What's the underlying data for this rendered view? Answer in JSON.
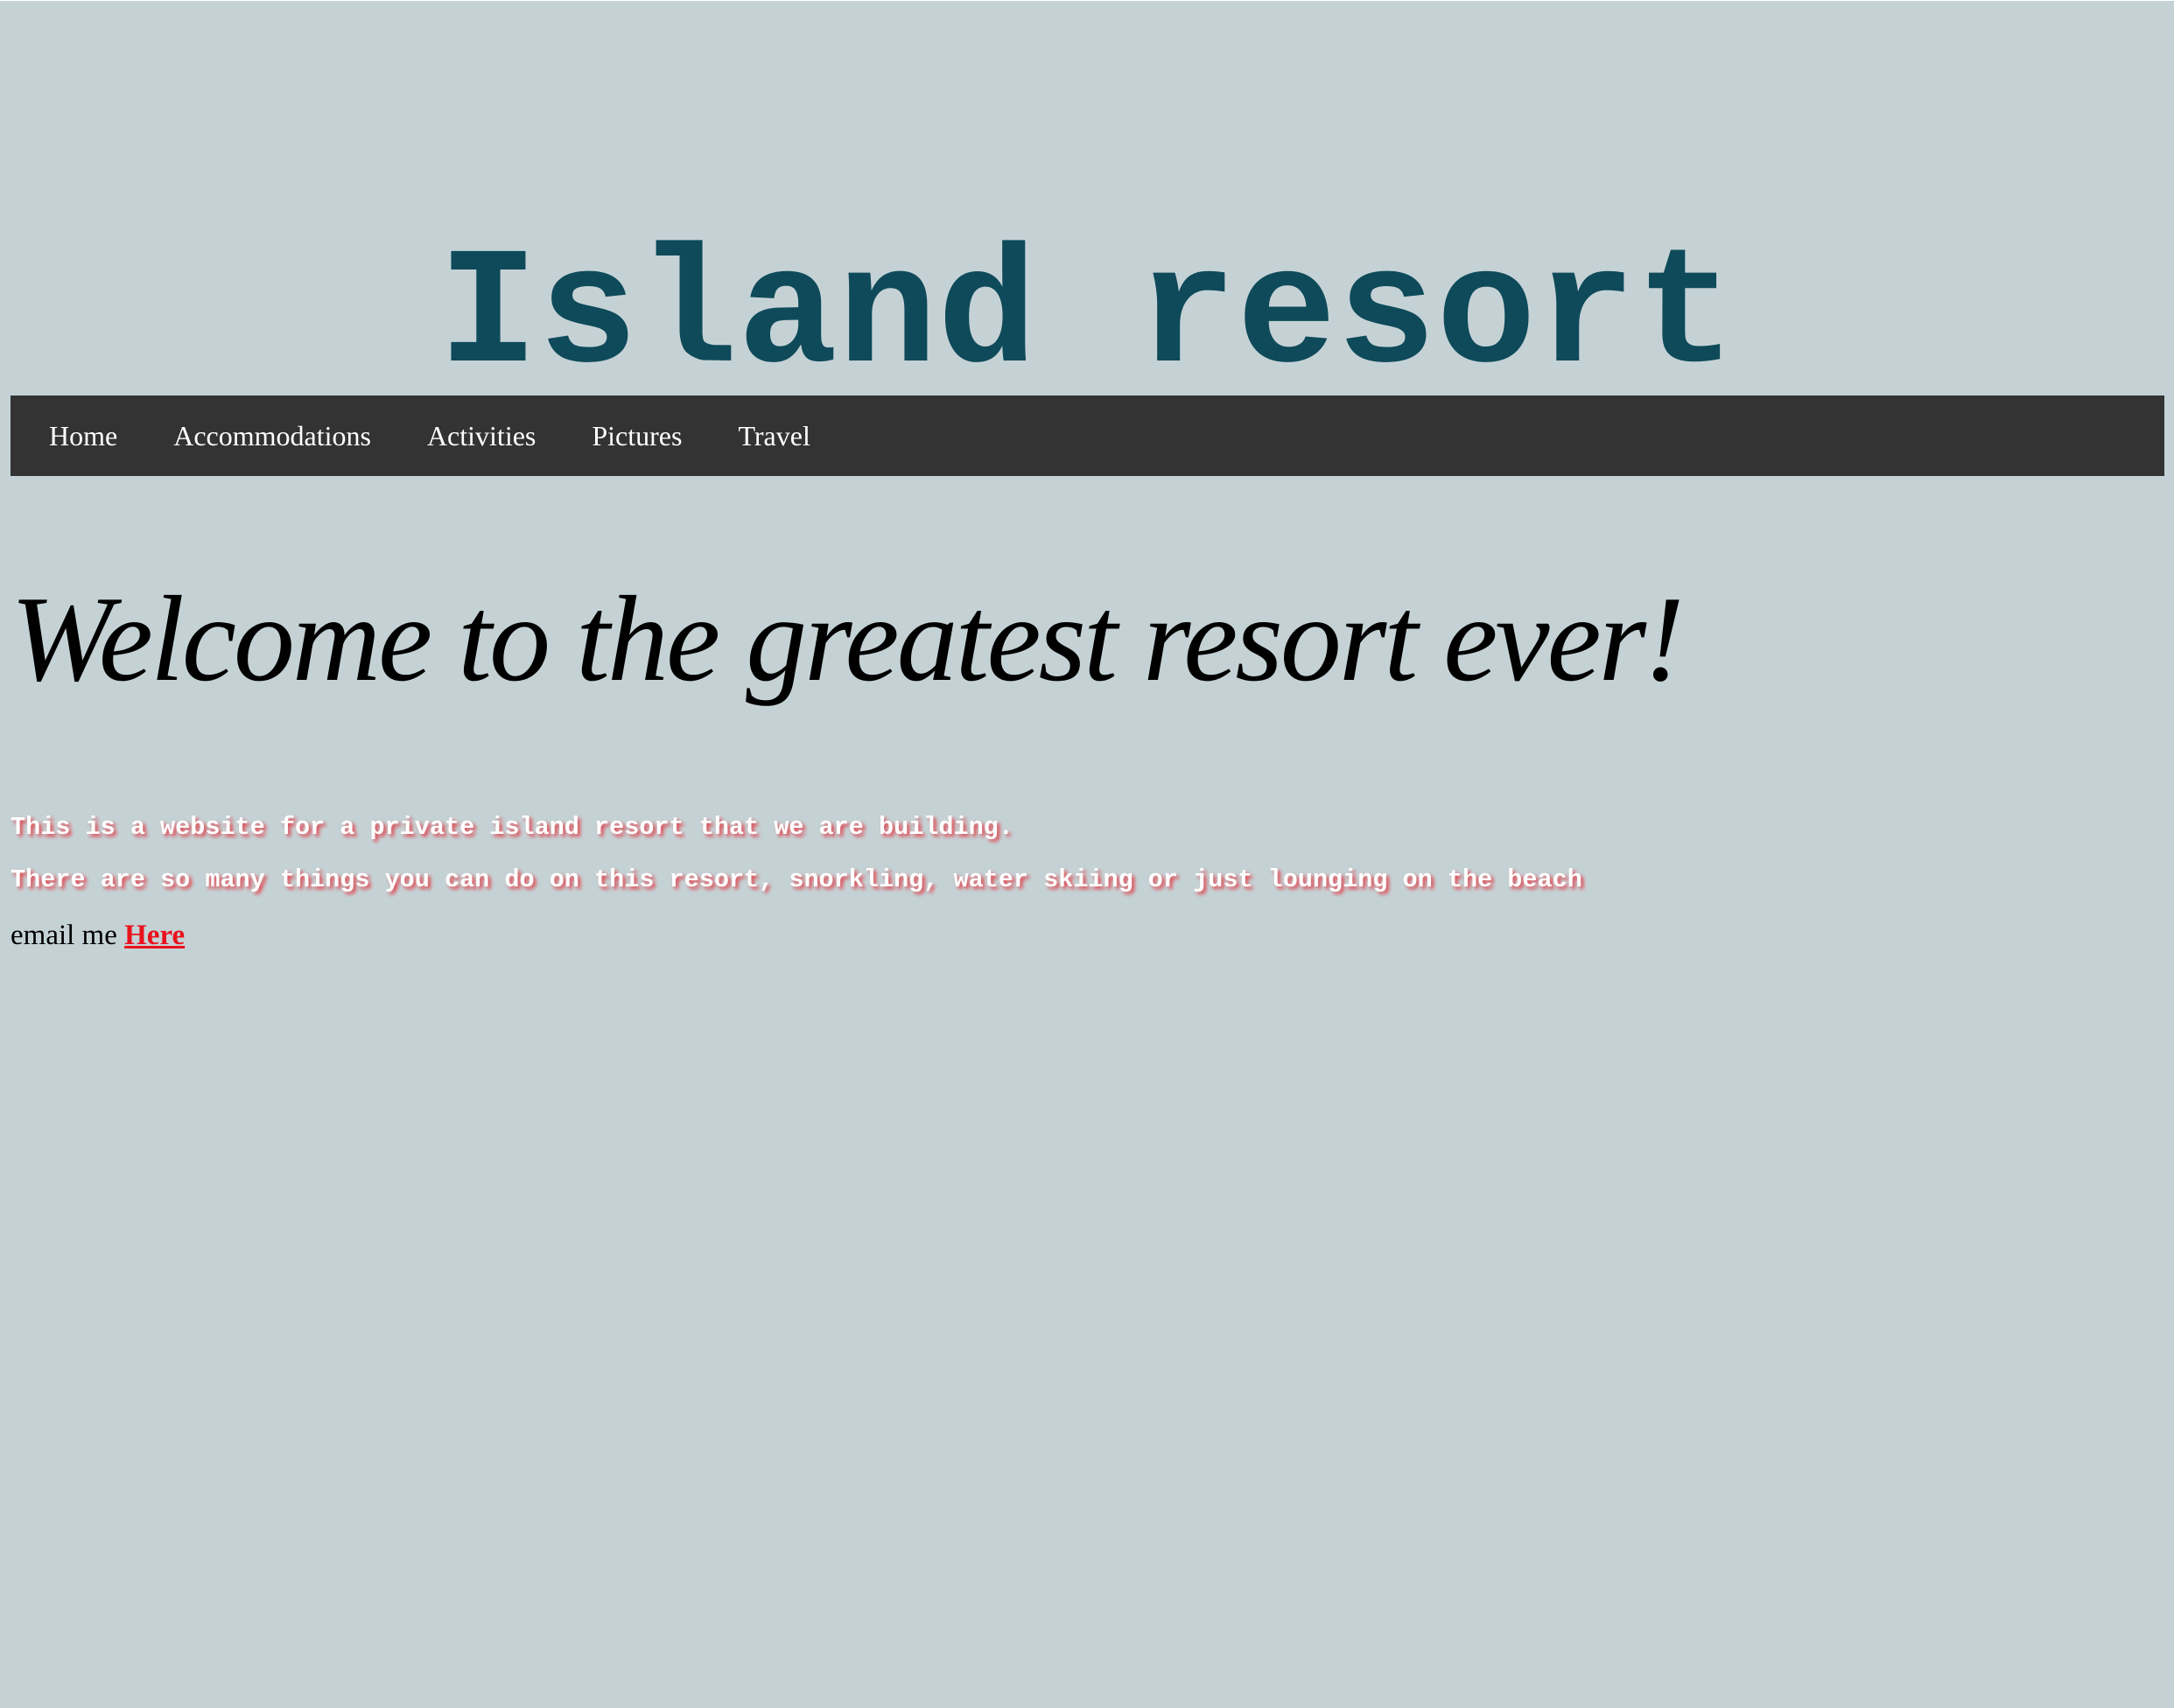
{
  "header": {
    "title": "Island resort"
  },
  "nav": {
    "items": [
      {
        "label": "Home"
      },
      {
        "label": "Accommodations"
      },
      {
        "label": "Activities"
      },
      {
        "label": "Pictures"
      },
      {
        "label": "Travel"
      }
    ]
  },
  "main": {
    "heading": "Welcome to the greatest resort ever!",
    "paragraphs": [
      "This is a website for a private island resort that we are building.",
      "There are so many things you can do on this resort, snorkling, water skiing or just lounging on the beach"
    ],
    "email_prefix": "email me",
    "email_link": "Here"
  },
  "colors": {
    "background": "#c5d2d5",
    "title": "#0e4a5a",
    "navbar": "#333333",
    "link": "#e8121e",
    "text_shadow": "#e0404a"
  }
}
